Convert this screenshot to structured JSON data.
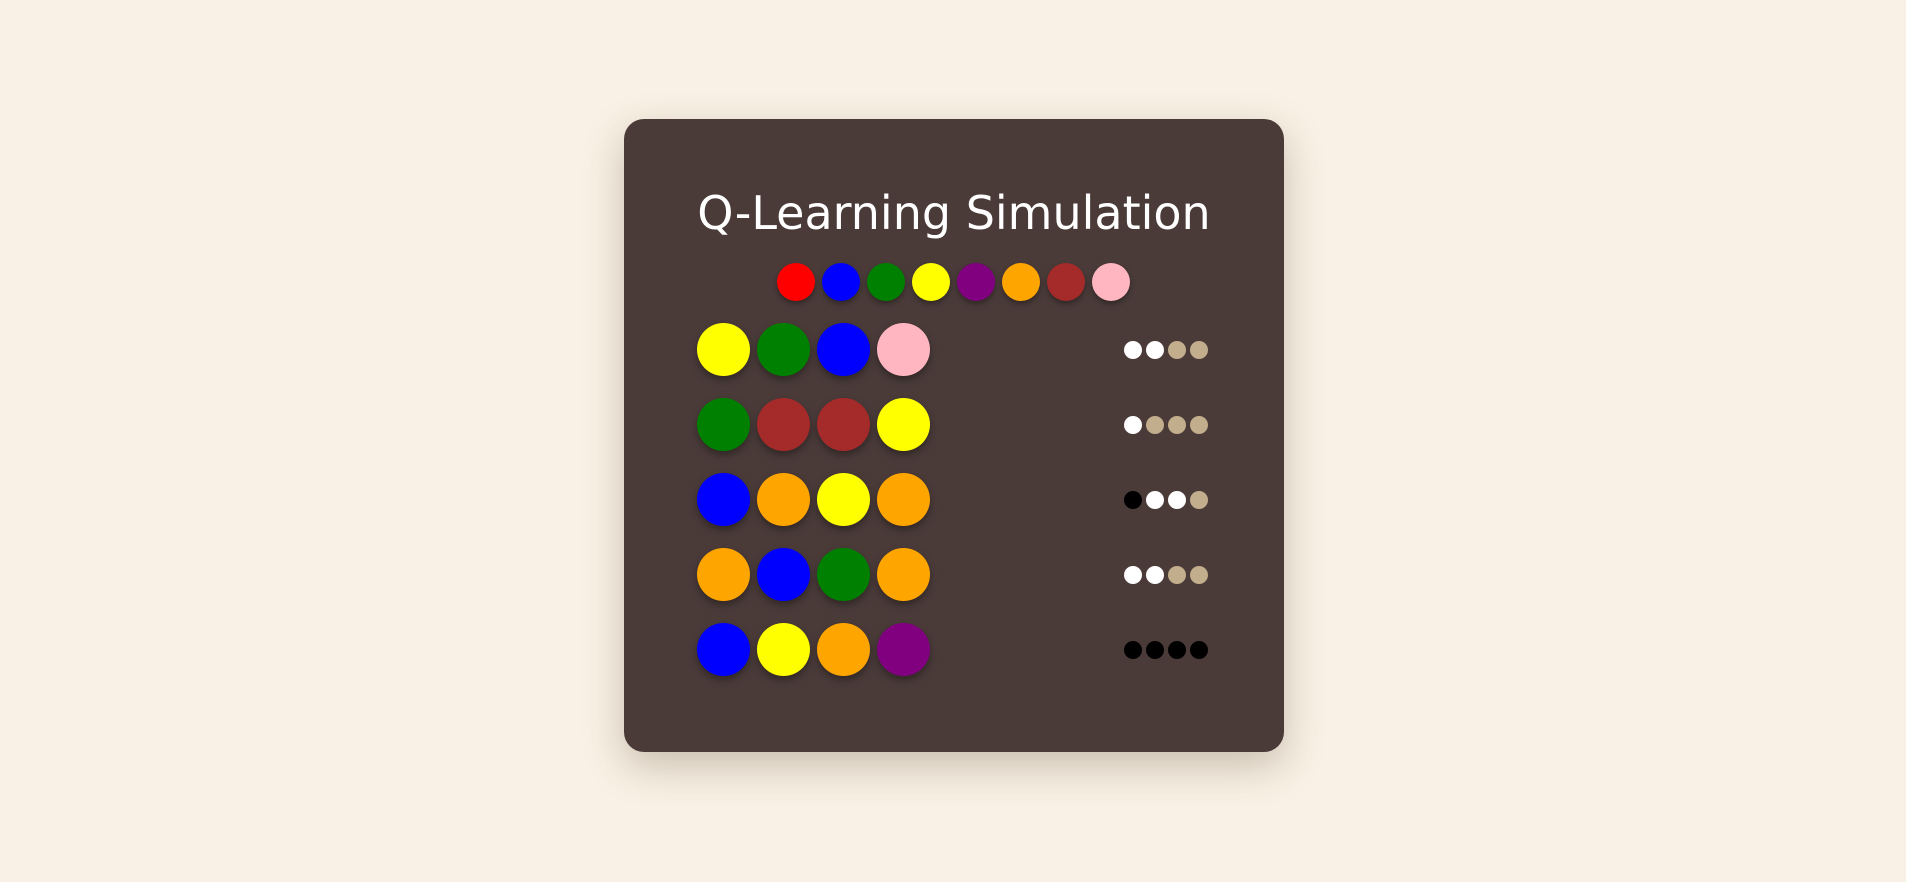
{
  "title": "Q-Learning Simulation",
  "colors": {
    "red": "#ff0000",
    "blue": "#0000ff",
    "green": "#008000",
    "yellow": "#ffff00",
    "purple": "#800080",
    "orange": "#ffa500",
    "brown": "#a52a2a",
    "pink": "#ffb6c1"
  },
  "feedback_colors": {
    "black": "#000000",
    "white": "#ffffff",
    "empty": "#c2ad8c"
  },
  "palette": [
    "red",
    "blue",
    "green",
    "yellow",
    "purple",
    "orange",
    "brown",
    "pink"
  ],
  "guesses": [
    {
      "pegs": [
        "yellow",
        "green",
        "blue",
        "pink"
      ],
      "feedback": [
        "white",
        "white",
        "empty",
        "empty"
      ]
    },
    {
      "pegs": [
        "green",
        "brown",
        "brown",
        "yellow"
      ],
      "feedback": [
        "white",
        "empty",
        "empty",
        "empty"
      ]
    },
    {
      "pegs": [
        "blue",
        "orange",
        "yellow",
        "orange"
      ],
      "feedback": [
        "black",
        "white",
        "white",
        "empty"
      ]
    },
    {
      "pegs": [
        "orange",
        "blue",
        "green",
        "orange"
      ],
      "feedback": [
        "white",
        "white",
        "empty",
        "empty"
      ]
    },
    {
      "pegs": [
        "blue",
        "yellow",
        "orange",
        "purple"
      ],
      "feedback": [
        "black",
        "black",
        "black",
        "black"
      ]
    }
  ]
}
